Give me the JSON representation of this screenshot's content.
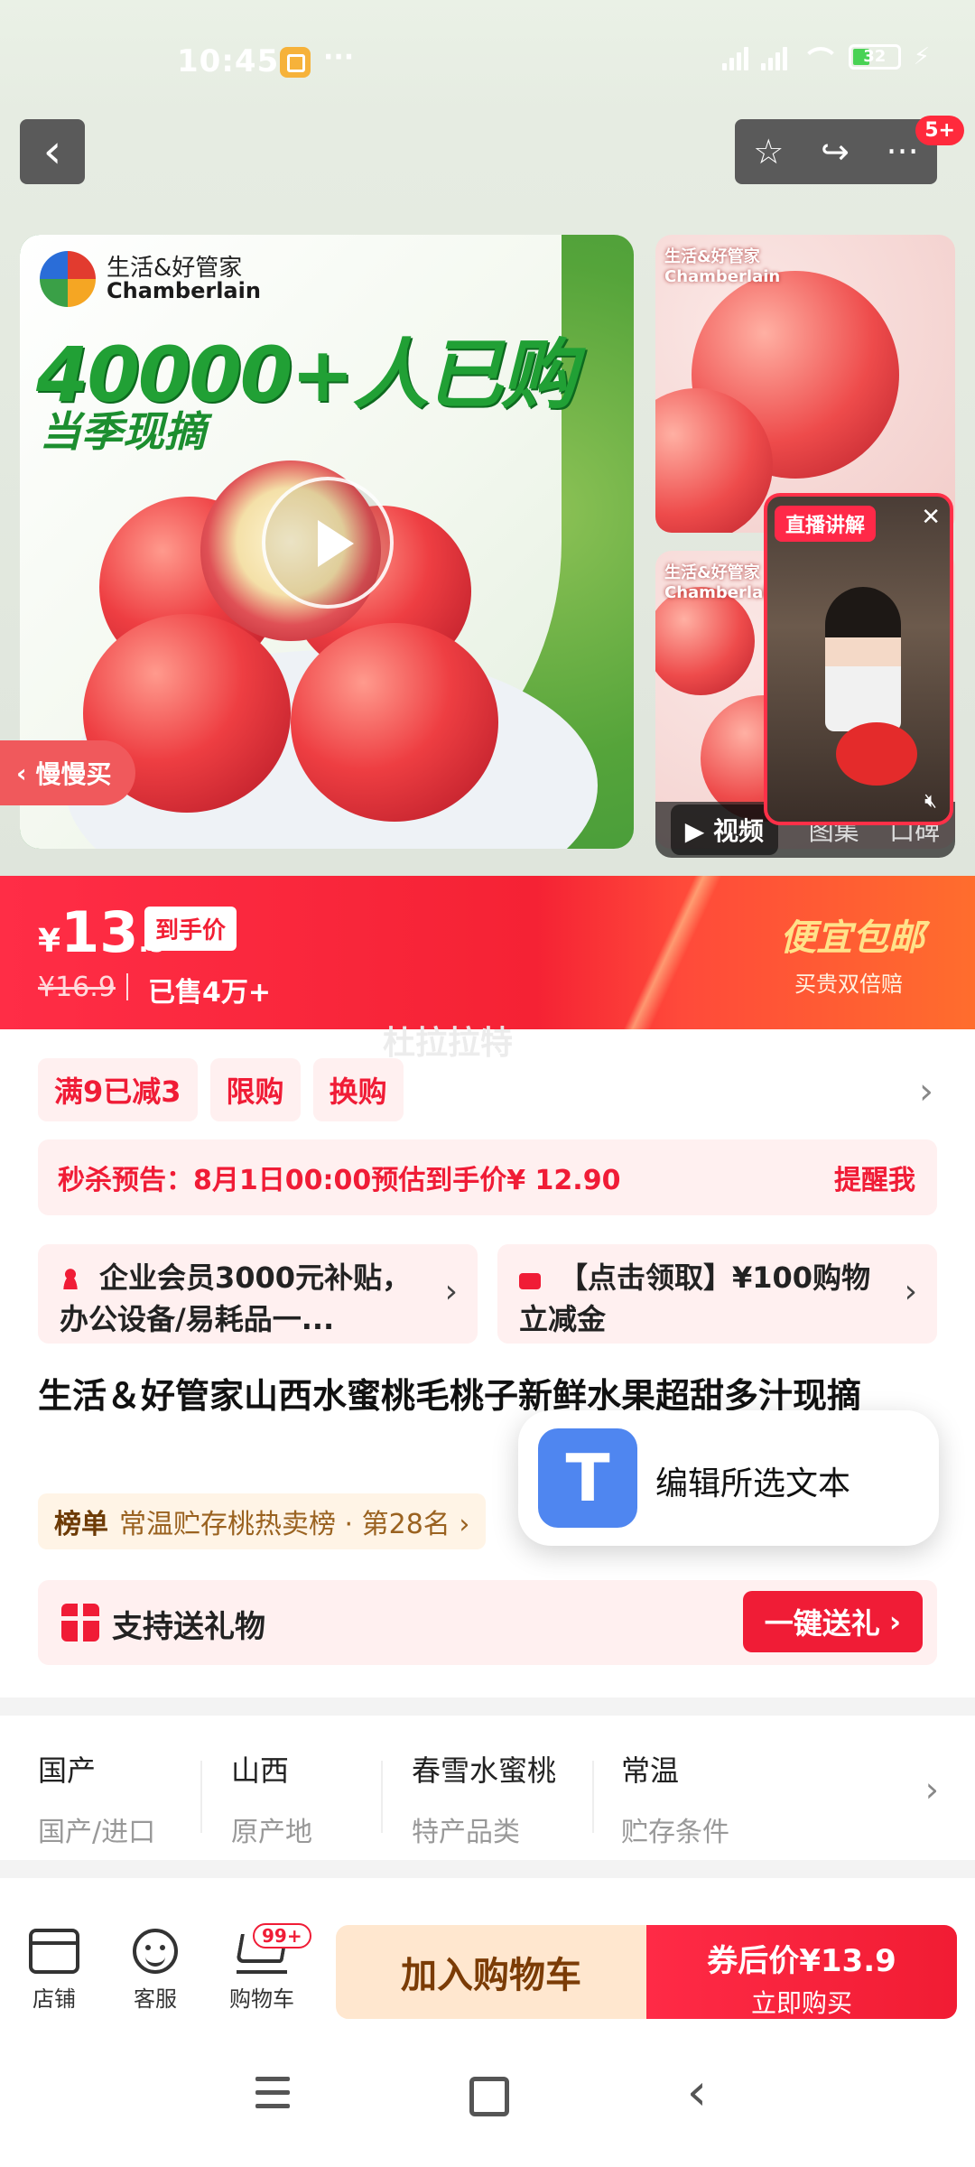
{
  "status_bar": {
    "time": "10:45",
    "more": "···",
    "battery": "32"
  },
  "header": {
    "back": "‹",
    "actions": [
      "☆",
      "↪",
      "···"
    ],
    "notification_badge": "5+"
  },
  "hero": {
    "brand_cn": "生活&好管家",
    "brand_en": "Chamberlain",
    "headline": "40000+人已购",
    "subline": "当季现摘",
    "slow_buy": "慢慢买",
    "live_tag": "直播讲解",
    "media_tabs": [
      "视频",
      "图集",
      "口碑"
    ]
  },
  "price": {
    "yen": "¥",
    "integer": "13",
    "decimal": ".9",
    "tag": "到手价",
    "original": "¥16.9",
    "sold": "已售4万+",
    "promo_title": "便宜包邮",
    "promo_sub": "买贵双倍赔"
  },
  "watermark": "杜拉拉特",
  "chips": [
    "满9已减3",
    "限购",
    "换购"
  ],
  "flash_sale": {
    "text": "秒杀预告：8月1日00:00预估到手价¥ 12.90",
    "action": "提醒我"
  },
  "promo_cards": [
    {
      "text": "企业会员3000元补贴，办公设备/易耗品一..."
    },
    {
      "text": "【点击领取】¥100购物立减金"
    }
  ],
  "product_title": "生活＆好管家山西水蜜桃毛桃子新鲜水果超甜多汁现摘",
  "ranking": {
    "label": "榜单",
    "text": "常温贮存桃热卖榜 · 第28名 ›"
  },
  "gift": {
    "label": "支持送礼物",
    "button": "一键送礼"
  },
  "attributes": [
    {
      "value": "国产",
      "key": "国产/进口"
    },
    {
      "value": "山西",
      "key": "原产地"
    },
    {
      "value": "春雪水蜜桃",
      "key": "特产品类"
    },
    {
      "value": "常温",
      "key": "贮存条件"
    }
  ],
  "bottom_bar": {
    "store": "店铺",
    "service": "客服",
    "cart": "购物车",
    "cart_badge": "99+",
    "add_to_cart": "加入购物车",
    "buy_title": "券后价¥13.9",
    "buy_sub": "立即购买"
  },
  "popup": {
    "icon_letter": "T",
    "label": "编辑所选文本"
  }
}
